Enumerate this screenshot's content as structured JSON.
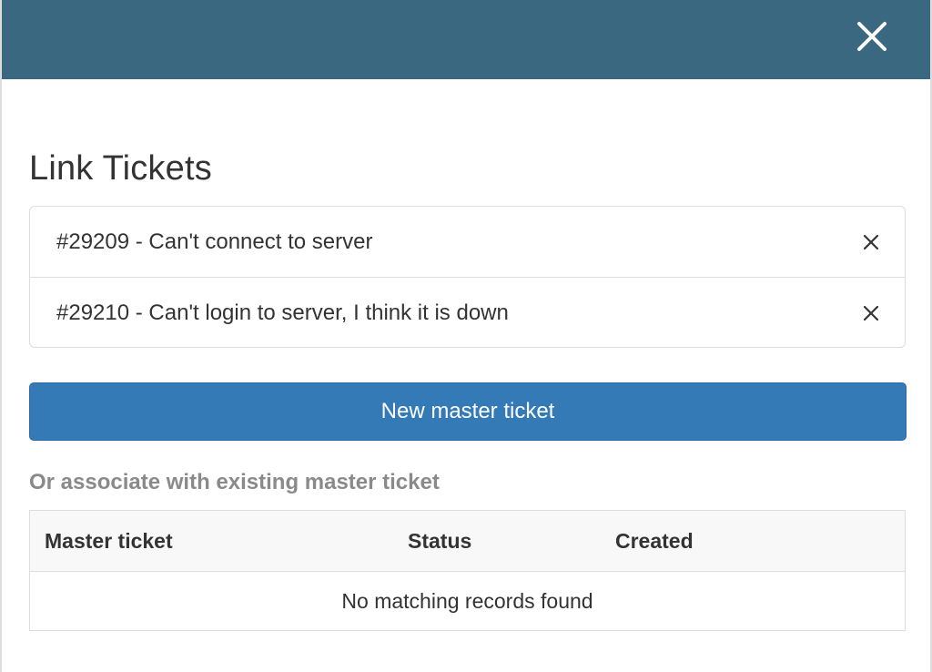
{
  "modal": {
    "title": "Link Tickets"
  },
  "tickets": [
    {
      "label": "#29209 - Can't connect to server"
    },
    {
      "label": "#29210 - Can't login to server, I think it is down"
    }
  ],
  "new_master_button": {
    "label": "New master ticket"
  },
  "associate": {
    "label": "Or associate with existing master ticket",
    "columns": [
      "Master ticket",
      "Status",
      "Created"
    ],
    "empty_message": "No matching records found"
  },
  "colors": {
    "header": "#3a6880",
    "primary": "#337ab7",
    "muted_label": "#8a8a8a"
  },
  "icons": {
    "close": "close-icon",
    "remove": "remove-icon"
  }
}
